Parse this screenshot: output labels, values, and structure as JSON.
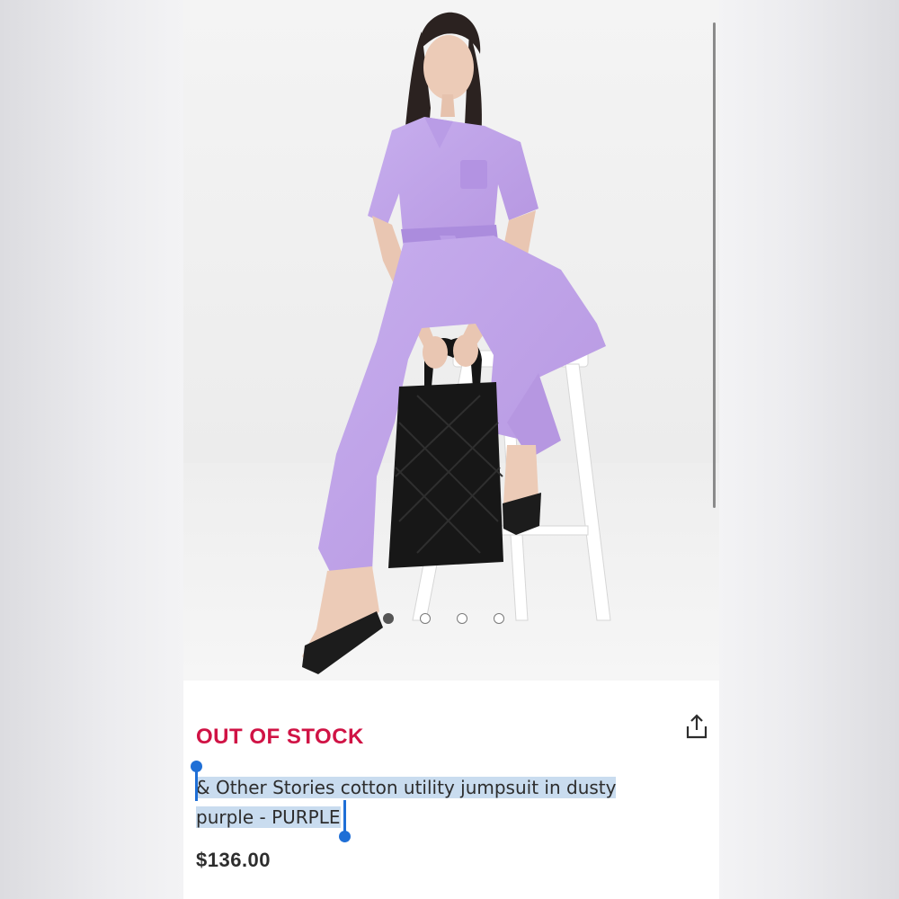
{
  "product": {
    "stock_status": "OUT OF STOCK",
    "title": "& Other Stories cotton utility jumpsuit in dusty purple - PURPLE",
    "title_line1": "& Other Stories cotton utility jumpsuit in dusty",
    "title_line2": "purple - PURPLE",
    "price": "$136.00",
    "image_description_icon": "product-photo",
    "gallery": {
      "total": 4,
      "active_index": 0
    }
  },
  "icons": {
    "share": "share-icon"
  },
  "colors": {
    "out_of_stock": "#d01345",
    "selection_highlight": "#c9dcef",
    "selection_handle": "#1f6fd6",
    "jumpsuit": "#c3a8e8"
  }
}
